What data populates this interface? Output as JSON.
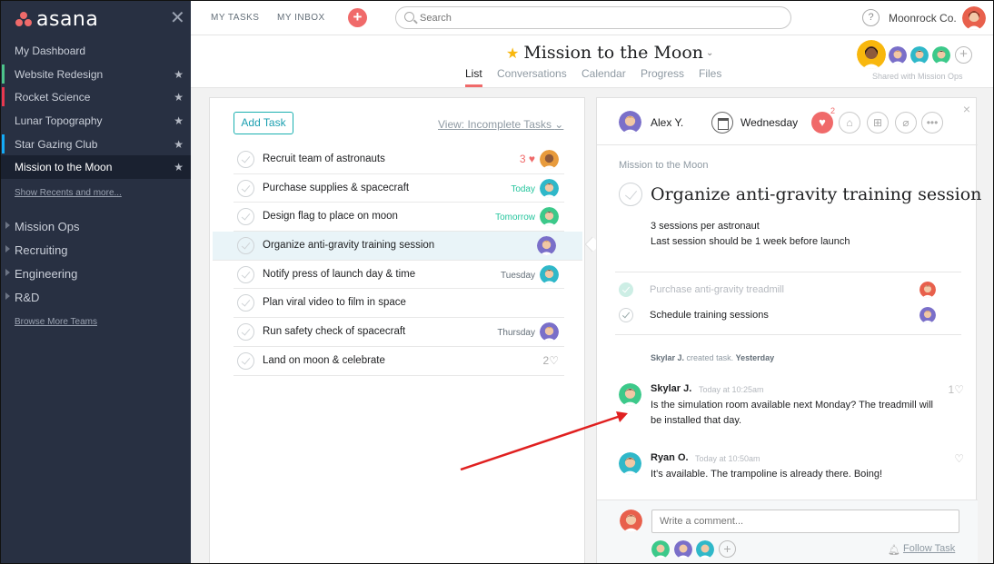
{
  "brand": {
    "name": "asana"
  },
  "sidebar": {
    "projects": [
      {
        "label": "My Dashboard",
        "starred": false,
        "bar_color": ""
      },
      {
        "label": "Website Redesign",
        "starred": true,
        "bar_color": "#4cc38a"
      },
      {
        "label": "Rocket Science",
        "starred": true,
        "bar_color": "#e8384f"
      },
      {
        "label": "Lunar Topography",
        "starred": true,
        "bar_color": ""
      },
      {
        "label": "Star Gazing Club",
        "starred": true,
        "bar_color": "#14aaf5"
      },
      {
        "label": "Mission to the Moon",
        "starred": true,
        "bar_color": "",
        "active": true
      }
    ],
    "show_recents": "Show Recents and more...",
    "teams": [
      "Mission Ops",
      "Recruiting",
      "Engineering",
      "R&D"
    ],
    "browse_teams": "Browse More Teams"
  },
  "topbar": {
    "my_tasks": "MY TASKS",
    "my_inbox": "MY INBOX",
    "add_label": "+",
    "search_placeholder": "Search",
    "help_label": "?",
    "org": "Moonrock Co."
  },
  "project": {
    "title": "Mission to the Moon",
    "tabs": [
      "List",
      "Conversations",
      "Calendar",
      "Progress",
      "Files"
    ],
    "active_tab": "List",
    "shared_with": "Shared with Mission Ops"
  },
  "list": {
    "add_task": "Add Task",
    "view": "View: Incomplete Tasks",
    "tasks": [
      {
        "name": "Recruit team of astronauts",
        "likes": "3",
        "due": "",
        "avatar_color": "#e89b3c"
      },
      {
        "name": "Purchase supplies & spacecraft",
        "likes": "",
        "due": "Today",
        "due_color": "green",
        "avatar_color": "#2fb8c9"
      },
      {
        "name": "Design flag to place on moon",
        "likes": "",
        "due": "Tomorrow",
        "due_color": "green",
        "avatar_color": "#3cc98a"
      },
      {
        "name": "Organize anti-gravity training session",
        "likes": "",
        "due": "",
        "avatar_color": "#7a6fc9",
        "selected": true
      },
      {
        "name": "Notify press of launch day & time",
        "likes": "",
        "due": "Tuesday",
        "avatar_color": "#2fb8c9"
      },
      {
        "name": "Plan viral video to film in space",
        "likes": "",
        "due": "",
        "avatar_color": ""
      },
      {
        "name": "Run safety check of spacecraft",
        "likes": "",
        "due": "Thursday",
        "avatar_color": "#7a6fc9"
      },
      {
        "name": "Land on moon & celebrate",
        "likes": "2",
        "likes_gray": true,
        "due": "",
        "avatar_color": ""
      }
    ]
  },
  "detail": {
    "assignee": "Alex Y.",
    "due": "Wednesday",
    "heart_count": "2",
    "close": "×",
    "project_crumb": "Mission to the Moon",
    "title": "Organize anti-gravity training session",
    "description_lines": [
      "3 sessions per astronaut",
      "Last session should be 1 week before launch"
    ],
    "subtasks": [
      {
        "name": "Purchase anti-gravity treadmill",
        "done": true
      },
      {
        "name": "Schedule training sessions",
        "done": false
      }
    ],
    "story": {
      "actor": "Skylar J.",
      "action": "created task.",
      "when": "Yesterday"
    },
    "comments": [
      {
        "name": "Skylar J.",
        "time": "Today at 10:25am",
        "text": "Is the simulation room available next Monday? The treadmill will be installed that day.",
        "likes": "1"
      },
      {
        "name": "Ryan O.",
        "time": "Today at 10:50am",
        "text": "It's available. The trampoline is already there. Boing!",
        "likes": ""
      }
    ],
    "comment_placeholder": "Write a comment...",
    "follow_label": "Follow Task"
  },
  "colors": {
    "accent": "#f06a6a",
    "sidebar": "#283042",
    "teal": "#25c59d"
  }
}
